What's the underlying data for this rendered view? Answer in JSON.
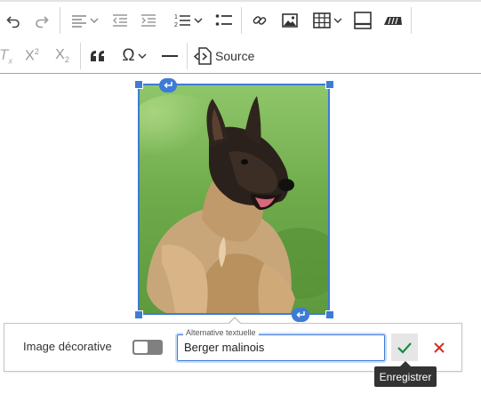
{
  "toolbar": {
    "buttons": [
      {
        "name": "undo-icon"
      },
      {
        "name": "redo-icon"
      },
      {
        "name": "align-left-icon"
      },
      {
        "name": "outdent-icon"
      },
      {
        "name": "indent-icon"
      },
      {
        "name": "numbered-list-icon"
      },
      {
        "name": "bulleted-list-icon"
      },
      {
        "name": "link-icon"
      },
      {
        "name": "image-icon"
      },
      {
        "name": "table-icon"
      },
      {
        "name": "page-break-icon"
      },
      {
        "name": "format-painter-icon"
      },
      {
        "name": "remove-format-icon"
      },
      {
        "name": "superscript-icon"
      },
      {
        "name": "subscript-icon"
      },
      {
        "name": "blockquote-icon"
      },
      {
        "name": "special-characters-icon"
      },
      {
        "name": "horizontal-line-icon"
      },
      {
        "name": "source-icon"
      }
    ],
    "source_label": "Source",
    "superscript_base": "X",
    "superscript_exp": "2",
    "subscript_base": "X",
    "subscript_sub": "2",
    "remove_format_glyph": "T",
    "remove_format_sub": "x",
    "quote_glyph": "❝❝",
    "omega_glyph": "Ω"
  },
  "image": {
    "subject": "malinois puppy on grass"
  },
  "alt_balloon": {
    "decorative_label": "Image décorative",
    "decorative_toggle_on": false,
    "alt_legend": "Alternative textuelle",
    "alt_value": "Berger malinois",
    "save_tooltip": "Enregistrer"
  },
  "colors": {
    "accent": "#3d7bd6",
    "save_check": "#1e8a3c",
    "cancel_x": "#d32f1e",
    "tooltip_bg": "#333333"
  }
}
